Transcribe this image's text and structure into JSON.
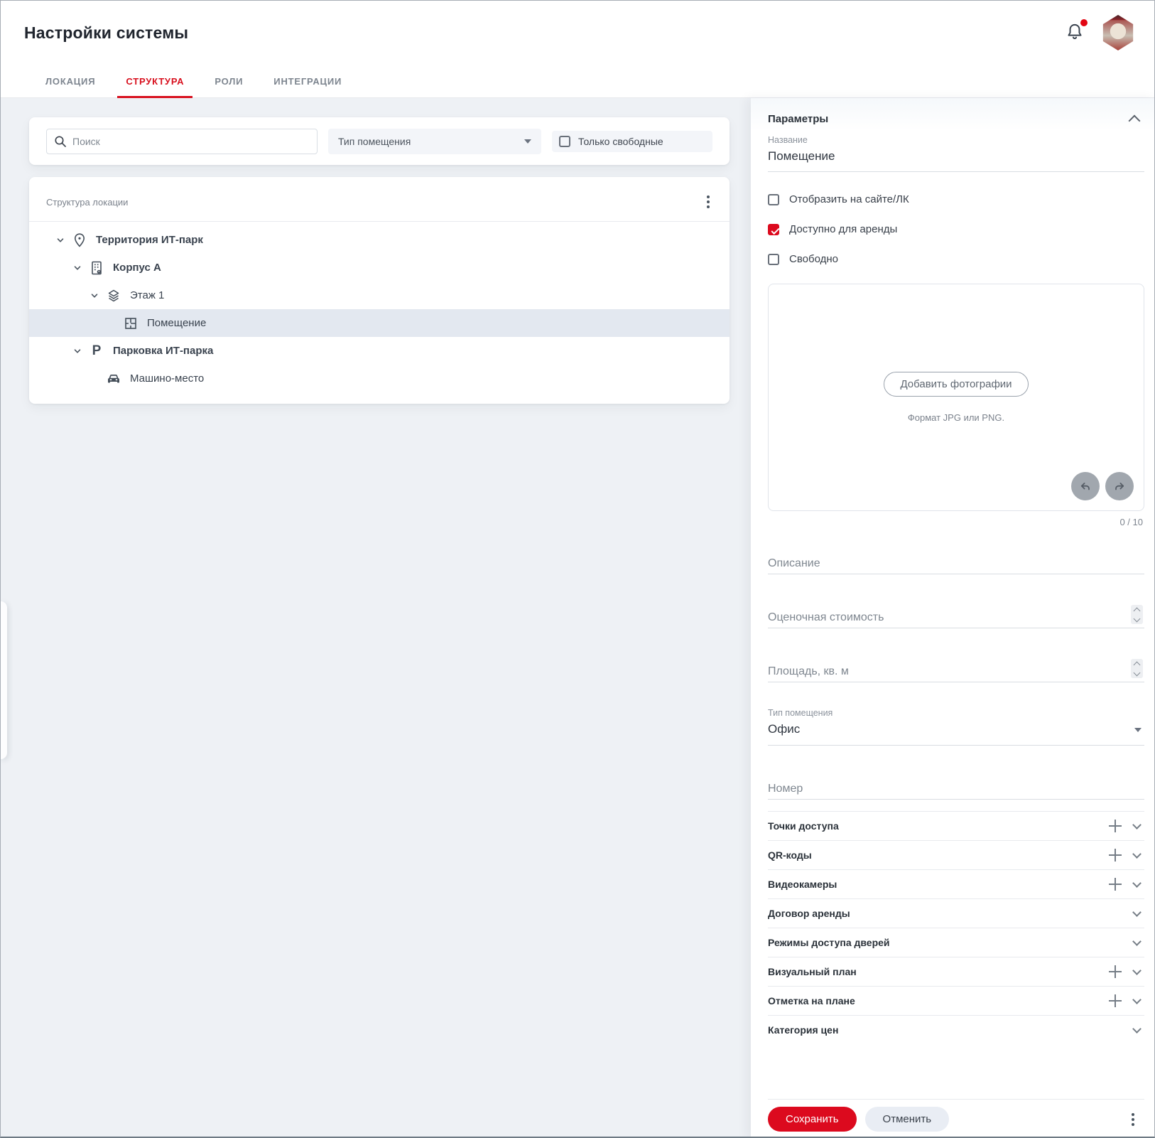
{
  "header": {
    "title": "Настройки системы"
  },
  "tabs": [
    {
      "label": "ЛОКАЦИЯ",
      "active": false
    },
    {
      "label": "СТРУКТУРА",
      "active": true
    },
    {
      "label": "РОЛИ",
      "active": false
    },
    {
      "label": "ИНТЕГРАЦИИ",
      "active": false
    }
  ],
  "filters": {
    "search_placeholder": "Поиск",
    "room_type_filter": "Тип помещения",
    "only_free_label": "Только свободные",
    "only_free_checked": false
  },
  "tree": {
    "title": "Структура локации",
    "items": [
      {
        "label": "Территория ИТ-парк",
        "icon": "location-pin",
        "level": 0,
        "chevron": true,
        "bold": true,
        "selected": false
      },
      {
        "label": "Корпус А",
        "icon": "building",
        "level": 1,
        "chevron": true,
        "bold": true,
        "selected": false
      },
      {
        "label": "Этаж 1",
        "icon": "layers",
        "level": 2,
        "chevron": true,
        "bold": false,
        "selected": false
      },
      {
        "label": "Помещение",
        "icon": "floor-plan",
        "level": 3,
        "chevron": false,
        "bold": false,
        "selected": true
      },
      {
        "label": "Парковка ИТ-парка",
        "icon": "parking",
        "level": 1,
        "chevron": true,
        "bold": true,
        "selected": false
      },
      {
        "label": "Машино-место",
        "icon": "car",
        "level": 2,
        "chevron": false,
        "bold": false,
        "selected": false
      }
    ]
  },
  "params": {
    "title": "Параметры",
    "name_label": "Название",
    "name_value": "Помещение",
    "checkboxes": [
      {
        "label": "Отобразить на сайте/ЛК",
        "checked": false
      },
      {
        "label": "Доступно для аренды",
        "checked": true
      },
      {
        "label": "Свободно",
        "checked": false
      }
    ],
    "photos": {
      "add_button": "Добавить фотографии",
      "hint": "Формат JPG или PNG.",
      "counter": "0 / 10"
    },
    "description_label": "Описание",
    "estimated_cost_label": "Оценочная стоимость",
    "area_label": "Площадь, кв. м",
    "room_type_label": "Тип помещения",
    "room_type_value": "Офис",
    "number_label": "Номер",
    "sections": [
      {
        "label": "Точки доступа",
        "add": true
      },
      {
        "label": "QR-коды",
        "add": true
      },
      {
        "label": "Видеокамеры",
        "add": true
      },
      {
        "label": "Договор аренды",
        "add": false
      },
      {
        "label": "Режимы доступа дверей",
        "add": false
      },
      {
        "label": "Визуальный план",
        "add": true
      },
      {
        "label": "Отметка на плане",
        "add": true
      },
      {
        "label": "Категория цен",
        "add": false
      }
    ],
    "save_label": "Сохранить",
    "cancel_label": "Отменить"
  },
  "colors": {
    "accent": "#dc0a1e",
    "selected_row": "#e3e8f0",
    "tab_active": "#d8101e"
  }
}
